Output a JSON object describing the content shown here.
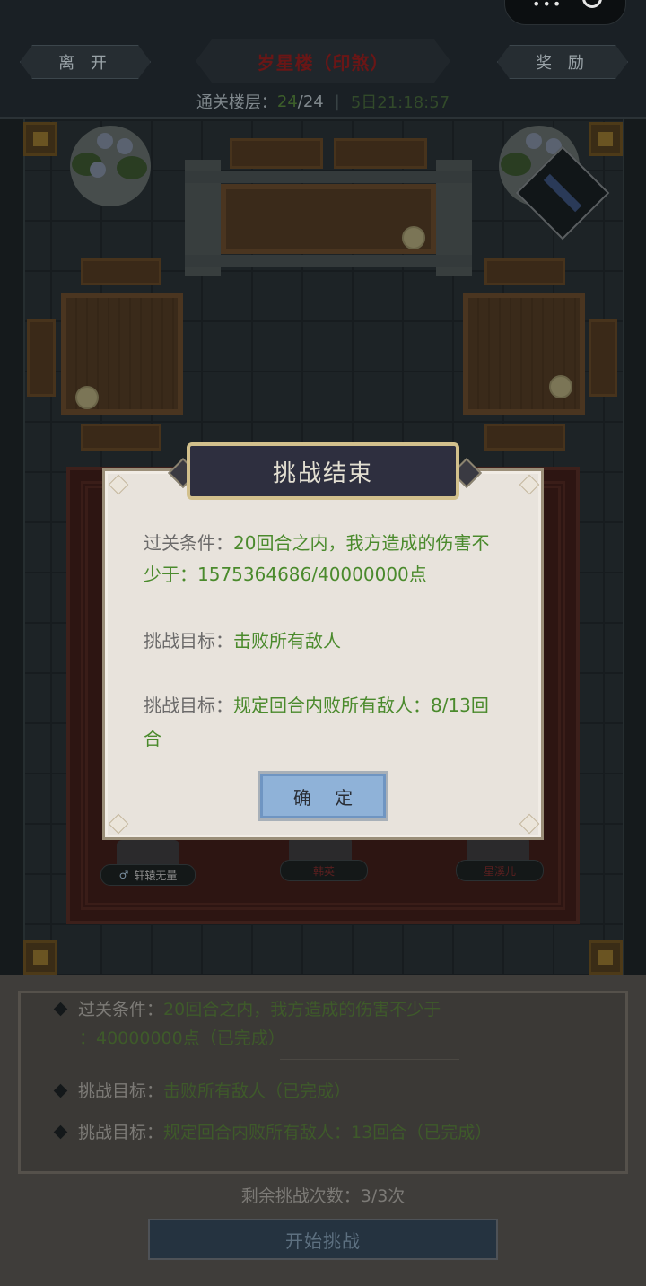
{
  "header": {
    "leave_label": "离 开",
    "reward_label": "奖 励",
    "stage_title": "岁星楼（印煞）",
    "floor_prefix": "通关楼层：",
    "floor_current": "24",
    "floor_total": "/24",
    "timer": "5日21:18:57"
  },
  "heroes": [
    {
      "name": "轩辕无量"
    },
    {
      "name": "韩英"
    },
    {
      "name": "星溪儿"
    }
  ],
  "conditions": {
    "items": [
      {
        "label": "过关条件：",
        "value": "20回合之内，我方造成的伤害不少于",
        "value2": "：40000000点（已完成）"
      },
      {
        "label": "挑战目标：",
        "value": "击败所有敌人（已完成）"
      },
      {
        "label": "挑战目标：",
        "value": "规定回合内败所有敌人：13回合（已完成）"
      }
    ],
    "remaining": "剩余挑战次数：3/3次",
    "start_label": "开始挑战"
  },
  "modal": {
    "title": "挑战结束",
    "line1_label": "过关条件：",
    "line1_value": "20回合之内，我方造成的伤害不",
    "line1_cont": "少于：1575364686/40000000点",
    "line2_label": "挑战目标：",
    "line2_value": "击败所有敌人",
    "line3_label": "挑战目标：",
    "line3_value": "规定回合内败所有敌人：8/13回",
    "line3_cont": "合",
    "ok_label": "确 定"
  },
  "colors": {
    "success_green": "#4a8a2c",
    "title_red": "#6a1616",
    "ok_blue": "#8fb2d8"
  }
}
